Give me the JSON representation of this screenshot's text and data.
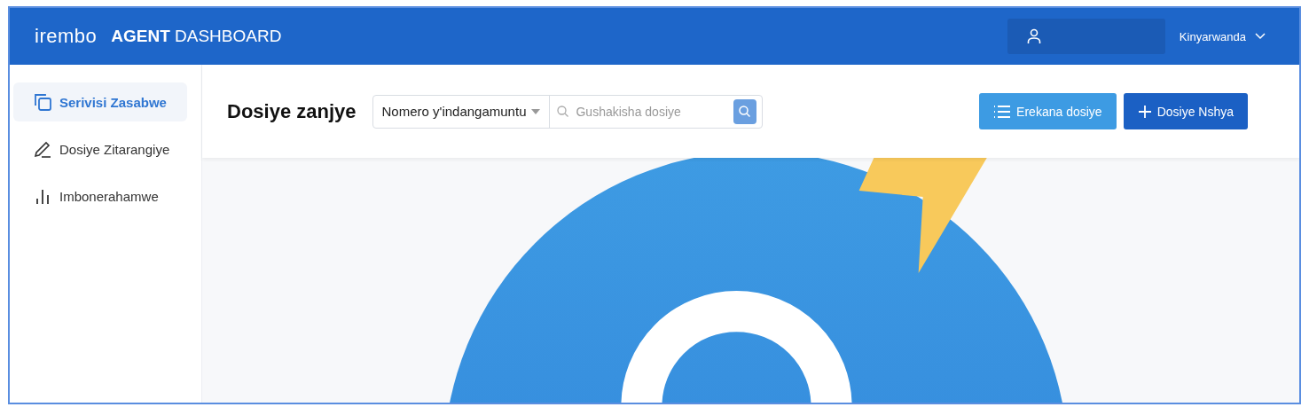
{
  "header": {
    "logo": "irembo",
    "title": "**AGENT** DASHBOARD",
    "language": "Kinyarwanda"
  },
  "sidebar": {
    "items": [
      {
        "label": "Serivisi Zasabwe",
        "kind": "copy",
        "selected": true
      },
      {
        "label": "Dosiye Zitarangiye",
        "kind": "pen",
        "selected": false
      },
      {
        "label": "Imbonerahamwe",
        "kind": "bars",
        "selected": false
      }
    ]
  },
  "toolbar": {
    "title": "Dosiye zanjye",
    "search_type": "Nomero y'indangamuntu",
    "search": {
      "placeholder": "Gushakisha dosiye"
    },
    "buttons": [
      {
        "label": "Erekana dosiye",
        "kind": "list"
      },
      {
        "label": "Dosiye Nshya",
        "kind": "plus"
      }
    ]
  }
}
